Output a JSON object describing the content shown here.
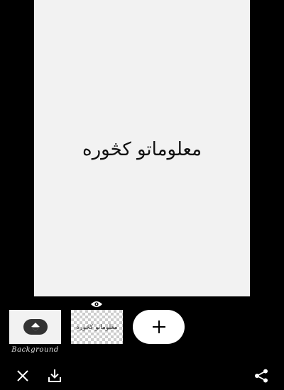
{
  "canvas": {
    "text": "معلوماتو کڅوره"
  },
  "layers": {
    "background_label": "Background",
    "text_layer_preview": "معلوماتو کڅوره",
    "add_label": "+"
  },
  "icons": {
    "visibility": "eye-icon",
    "background": "fill-icon",
    "close": "close-icon",
    "download": "download-icon",
    "share": "share-icon"
  },
  "colors": {
    "background": "#000000",
    "canvas": "#f2f2f2"
  }
}
